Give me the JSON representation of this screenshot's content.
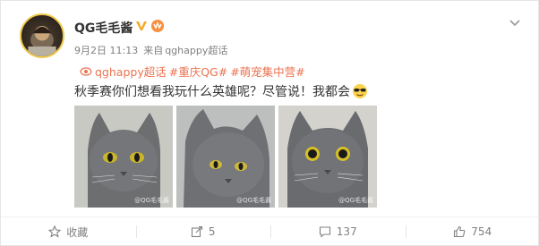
{
  "post": {
    "username": "QG毛毛酱",
    "date": "9月2日 11:13",
    "source_prefix": "来自",
    "source_name": "qghappy超话",
    "topics": [
      "qghappy超话",
      "#重庆QG#",
      "#萌宠集中营#"
    ],
    "text": "秋季赛你们想看我玩什么英雄呢？尽管说！我都会",
    "photos": [
      {
        "watermark": "@QG毛毛酱"
      },
      {
        "watermark": "@QG毛毛酱"
      },
      {
        "watermark": "@QG毛毛酱"
      }
    ]
  },
  "actions": {
    "favorite_label": "收藏",
    "share_count": "5",
    "comment_count": "137",
    "like_count": "754"
  },
  "colors": {
    "topic": "#eb7350",
    "verified": "#f5a623",
    "text": "#333333",
    "meta": "#808080"
  },
  "icons": [
    "verified-icon",
    "vip-icon",
    "chevron-down-icon",
    "supertopic-icon",
    "sunglasses-emoji-icon",
    "star-icon",
    "share-icon",
    "comment-icon",
    "like-icon"
  ]
}
